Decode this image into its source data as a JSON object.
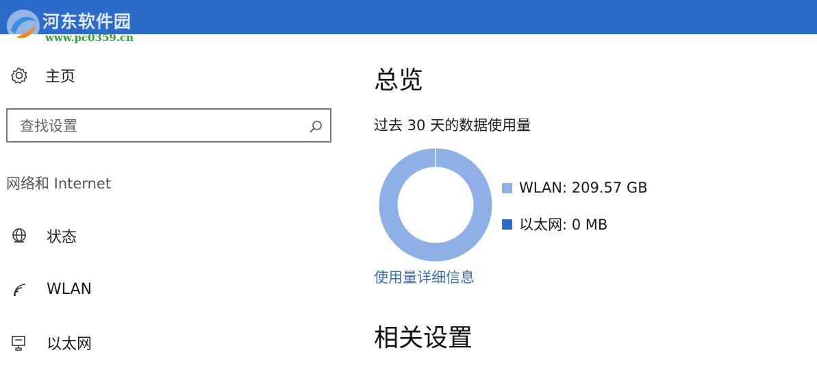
{
  "watermark": {
    "title": "河东软件园",
    "url": "www.pc0359.cn"
  },
  "sidebar": {
    "home_label": "主页",
    "search_placeholder": "查找设置",
    "section_title": "网络和 Internet",
    "items": [
      {
        "label": "状态",
        "icon": "globe-icon"
      },
      {
        "label": "WLAN",
        "icon": "wifi-icon"
      },
      {
        "label": "以太网",
        "icon": "ethernet-icon"
      }
    ]
  },
  "main": {
    "title": "总览",
    "subtitle": "过去 30 天的数据使用量",
    "details_link": "使用量详细信息",
    "related_title": "相关设置"
  },
  "chart_data": {
    "type": "pie",
    "title": "",
    "series": [
      {
        "name": "WLAN",
        "label": "WLAN: 209.57 GB",
        "value": 209.57,
        "unit": "GB",
        "color": "#8fb0e6"
      },
      {
        "name": "以太网",
        "label": "以太网: 0 MB",
        "value": 0,
        "unit": "MB",
        "color": "#2b6ccb"
      }
    ]
  },
  "colors": {
    "accent": "#2b6ccb",
    "link": "#3a6fb8",
    "wlan": "#8fb0e6"
  }
}
